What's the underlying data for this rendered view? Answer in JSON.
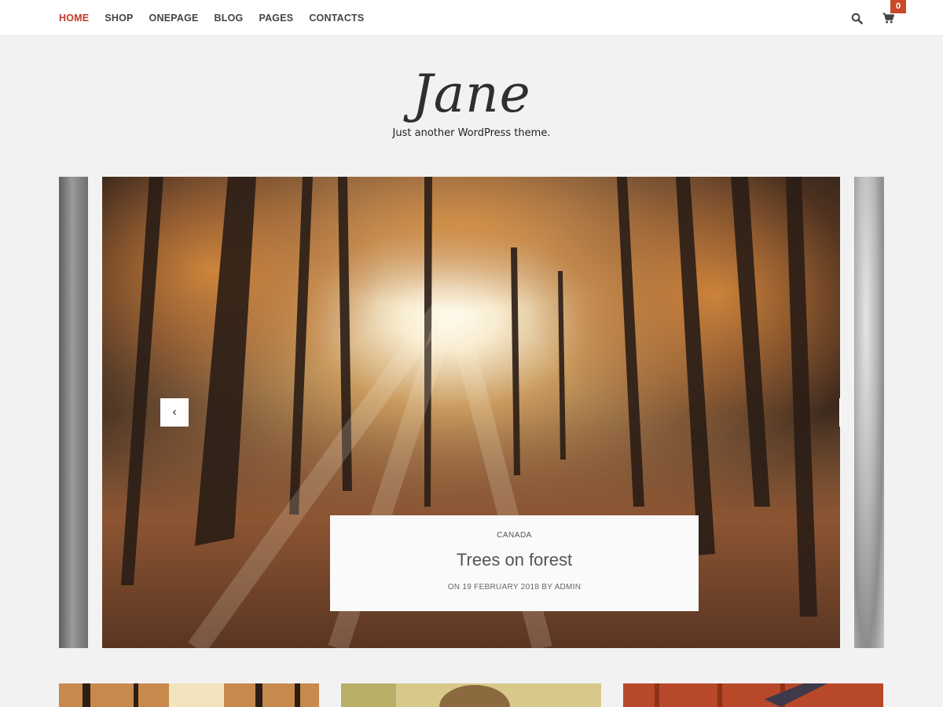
{
  "nav": {
    "items": [
      {
        "label": "HOME"
      },
      {
        "label": "SHOP"
      },
      {
        "label": "ONEPAGE"
      },
      {
        "label": "BLOG"
      },
      {
        "label": "PAGES"
      },
      {
        "label": "CONTACTS"
      }
    ],
    "active_color": "#c0392b",
    "search_icon": "search-icon",
    "cart_icon": "cart-icon",
    "cart_count": "0",
    "badge_color": "#c84a28"
  },
  "site": {
    "title": "Jane",
    "tagline": "Just another WordPress theme."
  },
  "slider": {
    "prev_symbol": "‹",
    "next_symbol": "›",
    "active_slide": {
      "category": "CANADA",
      "title": "Trees on forest",
      "meta": "ON 19 FEBRUARY 2018 BY ADMIN"
    }
  }
}
